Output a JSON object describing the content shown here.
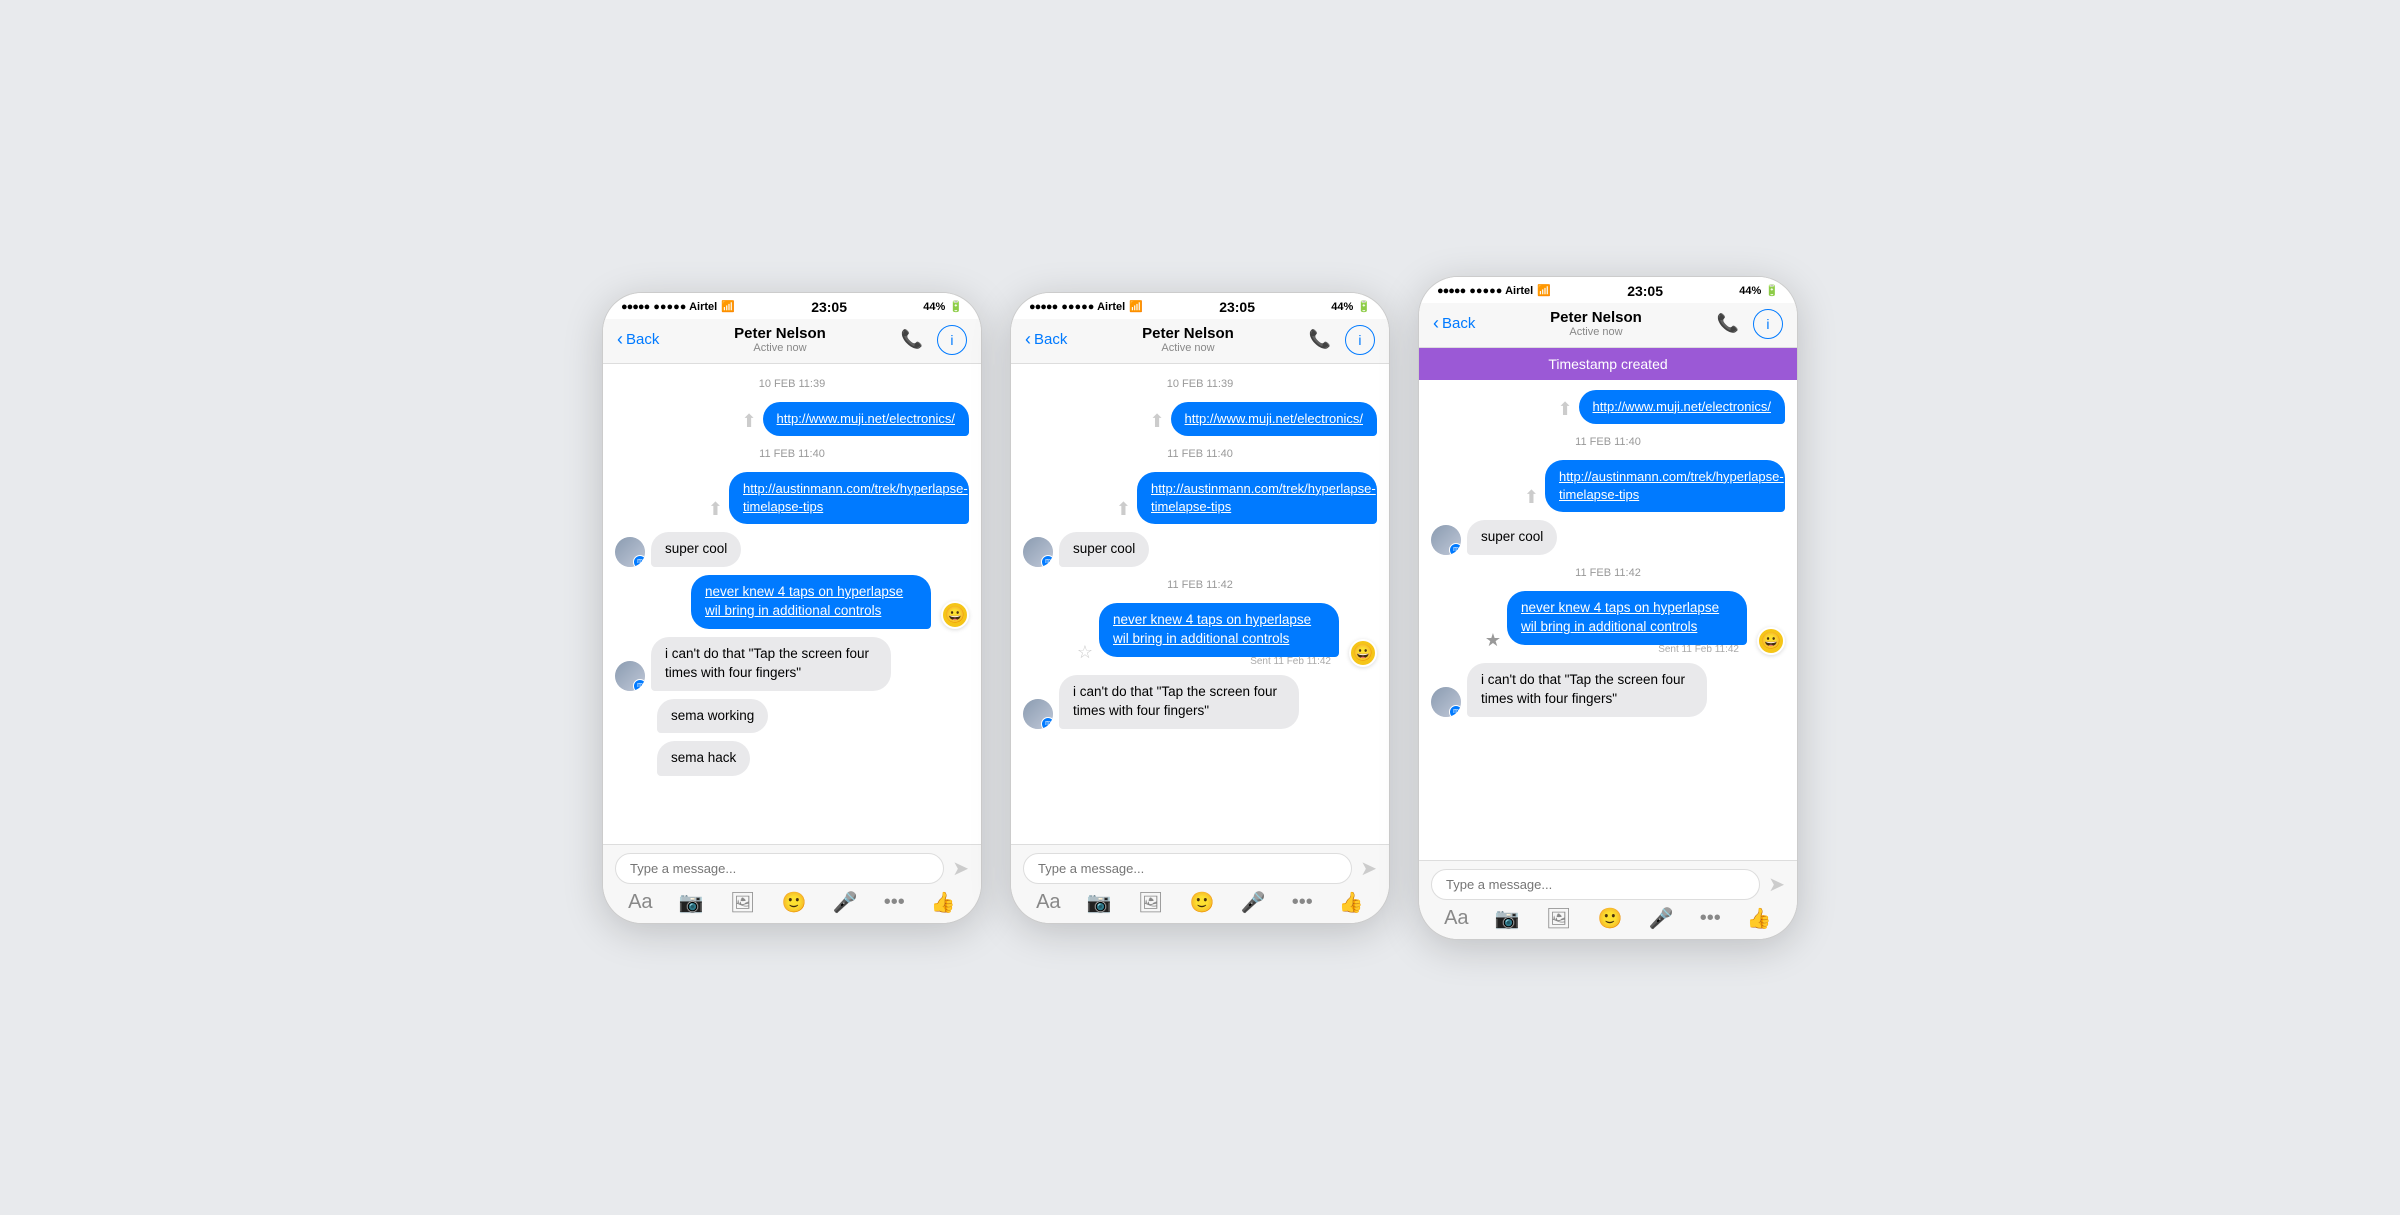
{
  "colors": {
    "blue": "#007aff",
    "purple": "#9b59d6",
    "bubble_out": "#007aff",
    "bubble_in": "#e9e9eb",
    "background": "#e8eaed",
    "nav_bg": "#f7f7f7"
  },
  "phone1": {
    "status_bar": {
      "carrier": "●●●●● Airtel",
      "wifi": "WiFi",
      "time": "23:05",
      "battery_pct": "44%"
    },
    "nav": {
      "back": "Back",
      "name": "Peter Nelson",
      "status": "Active now"
    },
    "messages": [
      {
        "type": "timestamp",
        "text": "10 FEB 11:39"
      },
      {
        "type": "outgoing_link",
        "text": "http://www.muji.net/electronics/"
      },
      {
        "type": "timestamp",
        "text": "11 FEB 11:40"
      },
      {
        "type": "outgoing_link",
        "text": "http://austinmann.com/trek/hyperlapse-timelapse-tips"
      },
      {
        "type": "incoming",
        "text": "super cool"
      },
      {
        "type": "outgoing",
        "text": "never knew 4 taps on hyperlapse wil bring in additional controls",
        "emoji": "😀"
      },
      {
        "type": "incoming_multi",
        "text1": "i can't do that \"Tap the screen four times with four fingers\"",
        "text2": "sema working",
        "text3": "sema hack"
      }
    ],
    "input": {
      "placeholder": "Type a message..."
    }
  },
  "phone2": {
    "status_bar": {
      "carrier": "●●●●● Airtel",
      "wifi": "WiFi",
      "time": "23:05",
      "battery_pct": "44%"
    },
    "nav": {
      "back": "Back",
      "name": "Peter Nelson",
      "status": "Active now"
    },
    "messages": [
      {
        "type": "timestamp",
        "text": "10 FEB 11:39"
      },
      {
        "type": "outgoing_link",
        "text": "http://www.muji.net/electronics/"
      },
      {
        "type": "timestamp",
        "text": "11 FEB 11:40"
      },
      {
        "type": "outgoing_link",
        "text": "http://austinmann.com/trek/hyperlapse-timelapse-tips"
      },
      {
        "type": "incoming",
        "text": "super cool"
      },
      {
        "type": "timestamp",
        "text": "11 FEB 11:42"
      },
      {
        "type": "outgoing_star",
        "text": "never knew 4 taps on hyperlapse wil bring in additional controls",
        "sent": "Sent 11 Feb 11:42",
        "emoji": "😀"
      },
      {
        "type": "incoming_single",
        "text": "i can't do that \"Tap the screen four times with four fingers\""
      }
    ],
    "input": {
      "placeholder": "Type a message..."
    }
  },
  "phone3": {
    "status_bar": {
      "carrier": "●●●●● Airtel",
      "wifi": "WiFi",
      "time": "23:05",
      "battery_pct": "44%"
    },
    "nav": {
      "back": "Back",
      "name": "Peter Nelson",
      "status": "Active now"
    },
    "timestamp_banner": "Timestamp created",
    "messages": [
      {
        "type": "outgoing_link",
        "text": "http://www.muji.net/electronics/"
      },
      {
        "type": "timestamp",
        "text": "11 FEB 11:40"
      },
      {
        "type": "outgoing_link",
        "text": "http://austinmann.com/trek/hyperlapse-timelapse-tips"
      },
      {
        "type": "incoming",
        "text": "super cool"
      },
      {
        "type": "timestamp",
        "text": "11 FEB 11:42"
      },
      {
        "type": "outgoing_star",
        "text": "never knew 4 taps on hyperlapse wil bring in additional controls",
        "sent": "Sent 11 Feb 11:42",
        "emoji": "😀"
      },
      {
        "type": "incoming_single",
        "text": "i can't do that \"Tap the screen four times with four fingers\""
      }
    ],
    "input": {
      "placeholder": "Type a message..."
    }
  },
  "toolbar": {
    "items": [
      "Aa",
      "📷",
      "🖼",
      "😊",
      "🎤",
      "•••",
      "👍"
    ]
  }
}
